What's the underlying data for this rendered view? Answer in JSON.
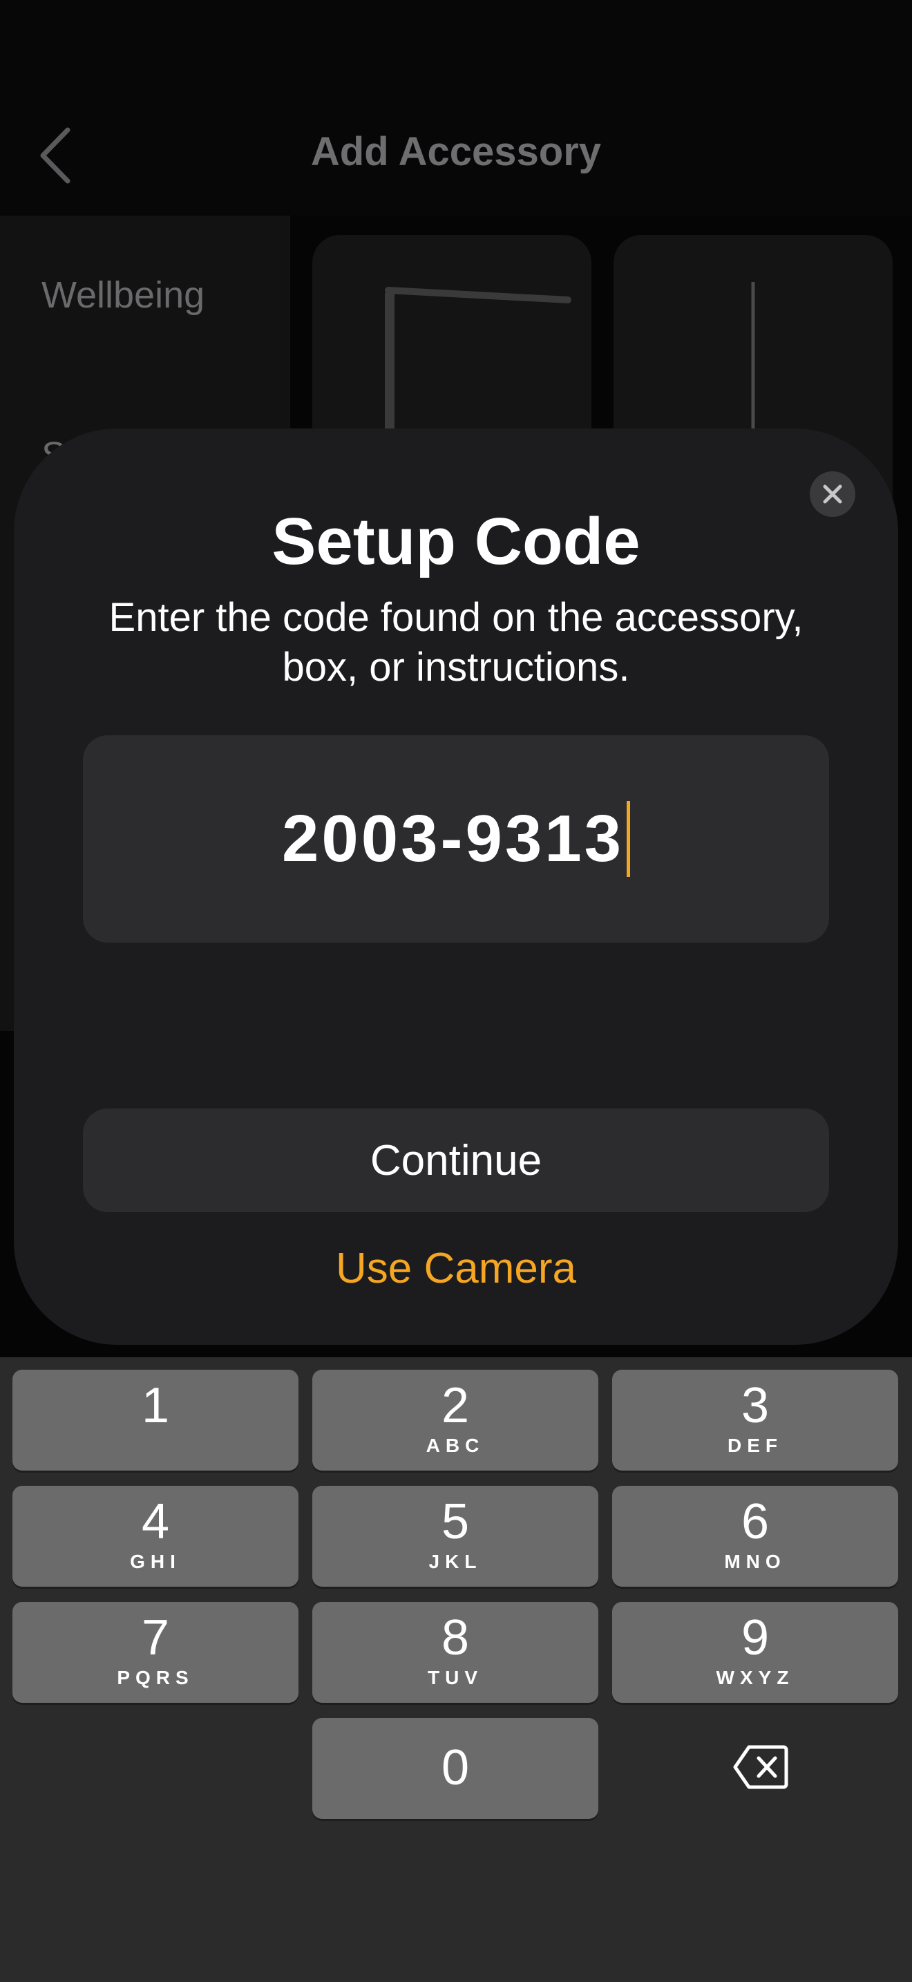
{
  "nav": {
    "title": "Add Accessory"
  },
  "sidebar": {
    "items": [
      {
        "label": "Wellbeing"
      },
      {
        "label": "S"
      }
    ]
  },
  "sheet": {
    "title": "Setup Code",
    "subtitle": "Enter the code found on the accessory, box, or instructions.",
    "code_value": "2003-9313",
    "continue_label": "Continue",
    "camera_label": "Use Camera"
  },
  "keypad": {
    "keys": [
      {
        "digit": "1",
        "letters": ""
      },
      {
        "digit": "2",
        "letters": "ABC"
      },
      {
        "digit": "3",
        "letters": "DEF"
      },
      {
        "digit": "4",
        "letters": "GHI"
      },
      {
        "digit": "5",
        "letters": "JKL"
      },
      {
        "digit": "6",
        "letters": "MNO"
      },
      {
        "digit": "7",
        "letters": "PQRS"
      },
      {
        "digit": "8",
        "letters": "TUV"
      },
      {
        "digit": "9",
        "letters": "WXYZ"
      },
      {
        "digit": "0",
        "letters": ""
      }
    ]
  },
  "colors": {
    "accent": "#f5a623",
    "sheet_background": "#1c1c1e",
    "field_background": "#2c2c2e",
    "key_background": "#6b6b6b"
  },
  "icons": {
    "back": "chevron-left-icon",
    "close": "close-icon",
    "delete": "backspace-icon"
  }
}
